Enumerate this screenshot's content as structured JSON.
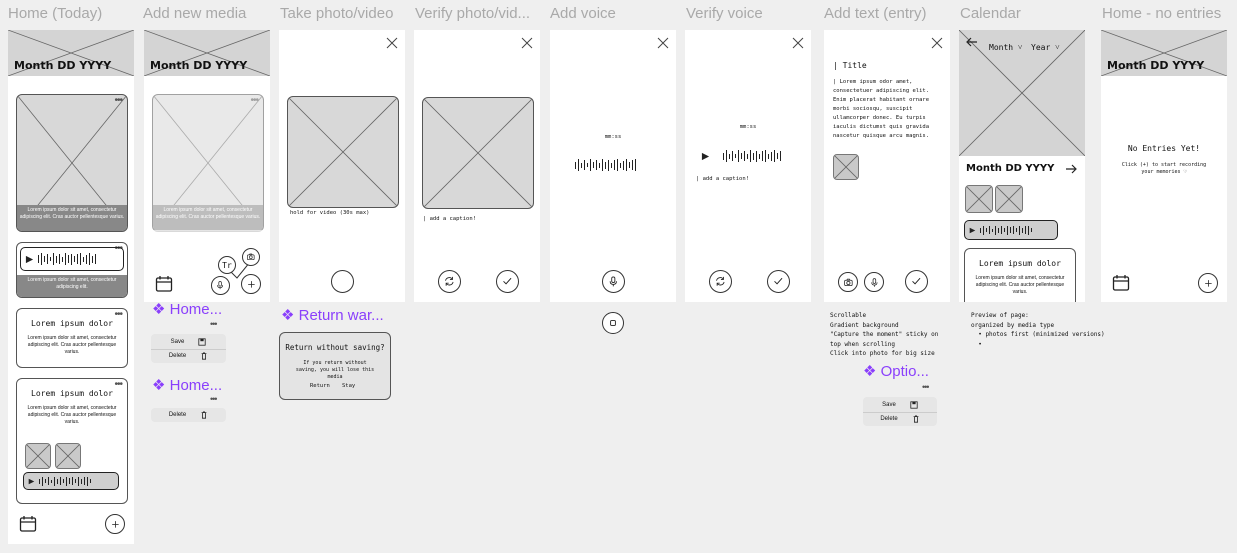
{
  "frames": [
    {
      "title": "Home (Today)"
    },
    {
      "title": "Add new media"
    },
    {
      "title": "Take photo/video"
    },
    {
      "title": "Verify photo/vid..."
    },
    {
      "title": "Add voice"
    },
    {
      "title": "Verify voice"
    },
    {
      "title": "Add text (entry)"
    },
    {
      "title": "Calendar"
    },
    {
      "title": "Home - no entries"
    }
  ],
  "home": {
    "date": "Month DD YYYY",
    "caption": "Lorem ipsum dolor sit amet, consectetur adipiscing elit. Cras auctor pellentesque varius.",
    "audio_caption": "Lorem ipsum dolor sit amet, consectetur adipiscing elit.",
    "card_title": "Lorem ipsum dolor",
    "card_body": "Lorem ipsum dolor sit amet, consectetur adipiscing elit. Cras auctor pellentesque varius."
  },
  "add_media": {
    "date": "Month DD YYYY",
    "caption": "Lorem ipsum dolor sit amet, consectetur adipiscing elit. Cras auctor pellentesque varius.",
    "text_icon": "Tr",
    "component_label_1": "❖ Home...",
    "component_label_2": "❖ Home...",
    "menu_save": "Save",
    "menu_delete": "Delete"
  },
  "take_photo": {
    "hint": "hold for video (30s max)",
    "component_label": "❖ Return war...",
    "dialog_title": "Return without saving?",
    "dialog_body": "If you return without saving, you will lose this media",
    "dialog_return": "Return",
    "dialog_stay": "Stay"
  },
  "verify_photo": {
    "caption_placeholder": "| add a caption!"
  },
  "add_voice": {
    "timer": "mm:ss"
  },
  "verify_voice": {
    "timer": "mm:ss",
    "caption_placeholder": "| add a caption!"
  },
  "add_text": {
    "title_placeholder": "| Title",
    "body": "| Lorem ipsum odor amet, consectetuer adipiscing elit. Enim placerat habitant ornare morbi sociosqu, suscipit ullamcorper donec. Eu turpis iaculis dictumst quis gravida nascetur quisque arcu magnis.",
    "note": "Scrollable\nGradient background\n\"Capture the moment\" sticky on\ntop when scrolling\nClick into photo for big size",
    "component_label": "❖ Optio...",
    "menu_save": "Save",
    "menu_delete": "Delete"
  },
  "calendar": {
    "month": "Month ˅",
    "year": "Year ˅",
    "date": "Month DD YYYY",
    "card_title": "Lorem ipsum dolor",
    "card_body": "Lorem ipsum dolor sit amet, consectetur adipiscing elit. Cras auctor pellentesque varius.",
    "note": "Preview of page:\norganized by media type\n  • photos first (minimized versions)\n  •"
  },
  "no_entries": {
    "date": "Month DD YYYY",
    "heading": "No Entries Yet!",
    "hint": "Click (+) to start recording your memories ♡"
  },
  "colors": {
    "accent": "#8a3ffc",
    "placeholder": "#d8d8d8",
    "title_gray": "#a9a9a9"
  }
}
